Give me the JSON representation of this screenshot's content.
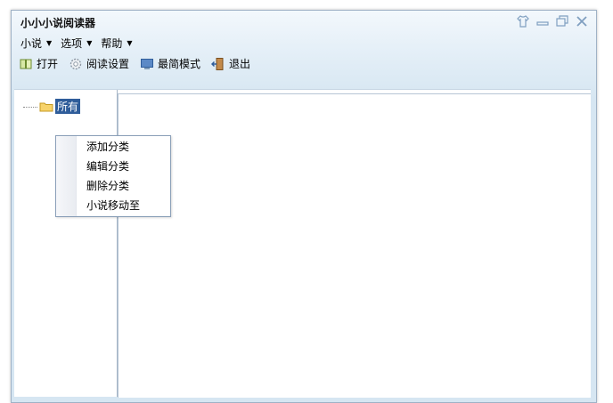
{
  "window": {
    "title": "小小小说阅读器"
  },
  "menubar": {
    "items": [
      {
        "label": "小说"
      },
      {
        "label": "选项"
      },
      {
        "label": "帮助"
      }
    ]
  },
  "toolbar": {
    "items": [
      {
        "label": "打开",
        "icon": "book-icon"
      },
      {
        "label": "阅读设置",
        "icon": "gear-icon"
      },
      {
        "label": "最简模式",
        "icon": "monitor-icon"
      },
      {
        "label": "退出",
        "icon": "exit-door-icon"
      }
    ]
  },
  "tree": {
    "root": {
      "label": "所有",
      "icon": "folder-icon"
    }
  },
  "context_menu": {
    "items": [
      {
        "label": "添加分类"
      },
      {
        "label": "编辑分类"
      },
      {
        "label": "删除分类"
      },
      {
        "label": "小说移动至"
      }
    ]
  },
  "colors": {
    "accent": "#2f5d9a",
    "titlebar_bg": "#e6f0f8",
    "border": "#9fb2c6"
  }
}
